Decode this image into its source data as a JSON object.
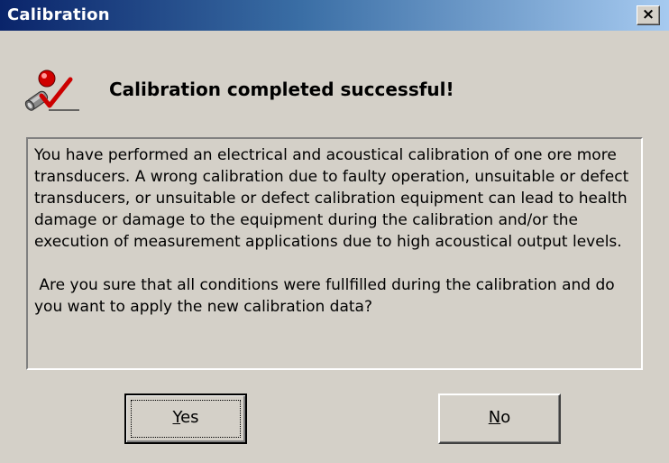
{
  "window": {
    "title": "Calibration",
    "close_label": "×"
  },
  "header": {
    "icon": "calibration-success-icon",
    "heading": "Calibration completed successful!"
  },
  "message": {
    "paragraph1": "You have performed an electrical and acoustical calibration of one ore more transducers. A wrong calibration due to faulty operation, unsuitable or defect transducers, or unsuitable or defect calibration equipment can lead to health damage or damage to the equipment during the calibration and/or the execution of measurement applications due to high acoustical output levels.",
    "paragraph2": "Are you sure that all conditions were fullfilled during the calibration and do you want to apply the new calibration data?"
  },
  "buttons": {
    "yes_mnemonic": "Y",
    "yes_rest": "es",
    "no_mnemonic": "N",
    "no_rest": "o"
  },
  "colors": {
    "titlebar_start": "#0a246a",
    "titlebar_end": "#a6caf0",
    "face": "#d4d0c8",
    "check_red": "#cc0000"
  }
}
